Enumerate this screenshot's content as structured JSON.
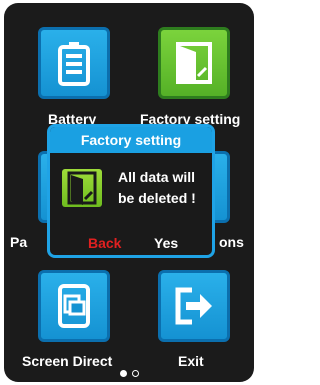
{
  "apps": {
    "battery": {
      "label": "Battery",
      "icon": "battery-icon"
    },
    "factory_setting": {
      "label": "Factory setting",
      "icon": "door-exit-icon"
    },
    "passcode": {
      "label": "Pa",
      "icon": "passcode-icon"
    },
    "options": {
      "label": "ons",
      "icon": "options-icon"
    },
    "screen_direct": {
      "label": "Screen Direct",
      "icon": "screen-rotate-icon"
    },
    "exit": {
      "label": "Exit",
      "icon": "exit-arrow-icon"
    }
  },
  "dialog": {
    "title": "Factory setting",
    "message_line1": "All data will",
    "message_line2": "be deleted !",
    "back_label": "Back",
    "yes_label": "Yes",
    "icon": "factory-reset-icon"
  },
  "pager": {
    "pages": 2,
    "current": 1
  },
  "colors": {
    "screen_bg": "#1b1b1b",
    "tile_blue": "#1a9fe0",
    "tile_green": "#5cb82b",
    "back_red": "#e02020",
    "text_white": "#ffffff"
  }
}
